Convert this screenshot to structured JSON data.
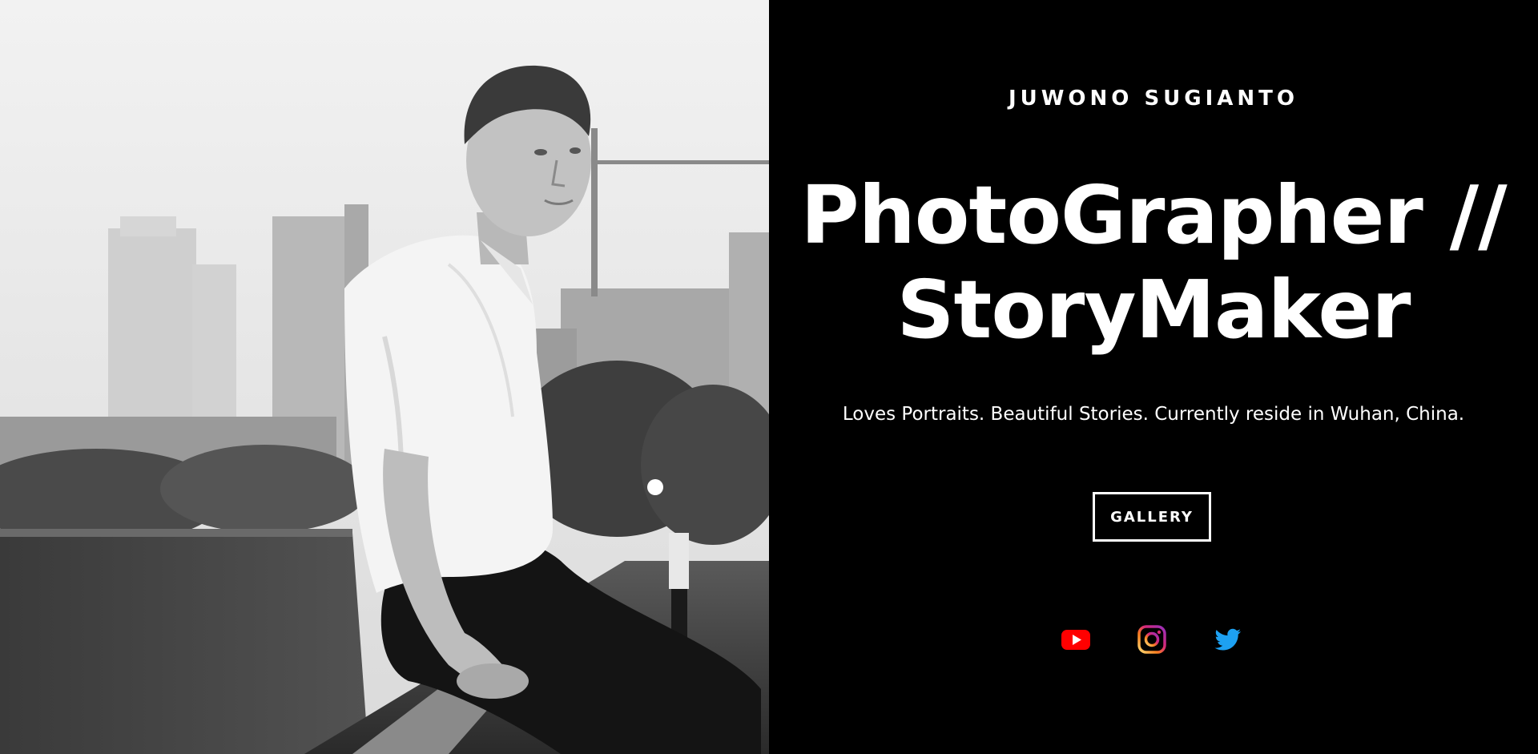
{
  "hero": {
    "photographer_name": "JUWONO SUGIANTO",
    "headline_line1": "PhotoGrapher //",
    "headline_line2": "StoryMaker",
    "tagline": "Loves Portraits. Beautiful Stories. Currently reside in Wuhan, China.",
    "gallery_label": "GALLERY"
  },
  "social": [
    {
      "icon": "youtube-icon",
      "color": "#ff0000"
    },
    {
      "icon": "instagram-icon",
      "color": "#e1306c"
    },
    {
      "icon": "twitter-icon",
      "color": "#1da1f2"
    }
  ],
  "colors": {
    "panel_background": "#000000",
    "text": "#ffffff"
  }
}
